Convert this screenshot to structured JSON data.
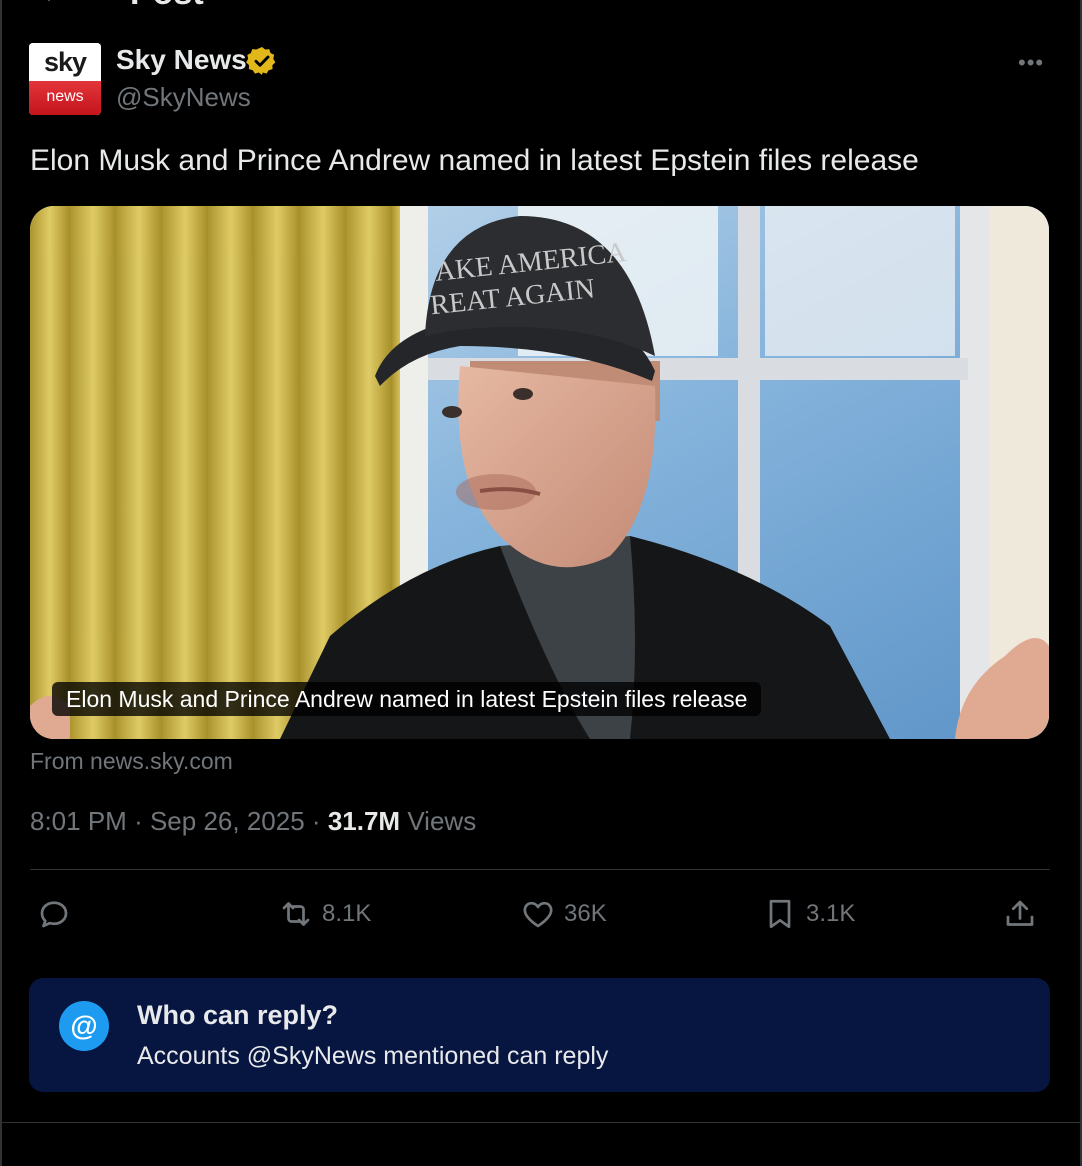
{
  "header": {
    "title": "Post",
    "back_icon": "back-arrow-icon"
  },
  "author": {
    "avatar_top": "sky",
    "avatar_bottom": "news",
    "name": "Sky News",
    "handle": "@SkyNews",
    "verified_color": "#e2b719"
  },
  "post": {
    "text": "Elon Musk and Prince Andrew named in latest Epstein files release",
    "media_caption": "Elon Musk and Prince Andrew named in latest Epstein files release",
    "hat_text_line1": "AKE AMERICA",
    "hat_text_line2": "REAT AGAIN",
    "source": "From news.sky.com",
    "time": "8:01 PM",
    "date": "Sep 26, 2025",
    "separator": "·",
    "views_count": "31.7M",
    "views_label": "Views"
  },
  "actions": {
    "reply_icon": "reply-icon",
    "repost_count": "8.1K",
    "like_count": "36K",
    "bookmark_count": "3.1K",
    "share_icon": "share-icon"
  },
  "reply_restriction": {
    "icon_text": "@",
    "title": "Who can reply?",
    "subtitle": "Accounts @SkyNews mentioned can reply"
  },
  "colors": {
    "background": "#000000",
    "text": "#e7e9ea",
    "secondary": "#71767b",
    "accent": "#1d9bf0",
    "reply_box": "#071541"
  }
}
